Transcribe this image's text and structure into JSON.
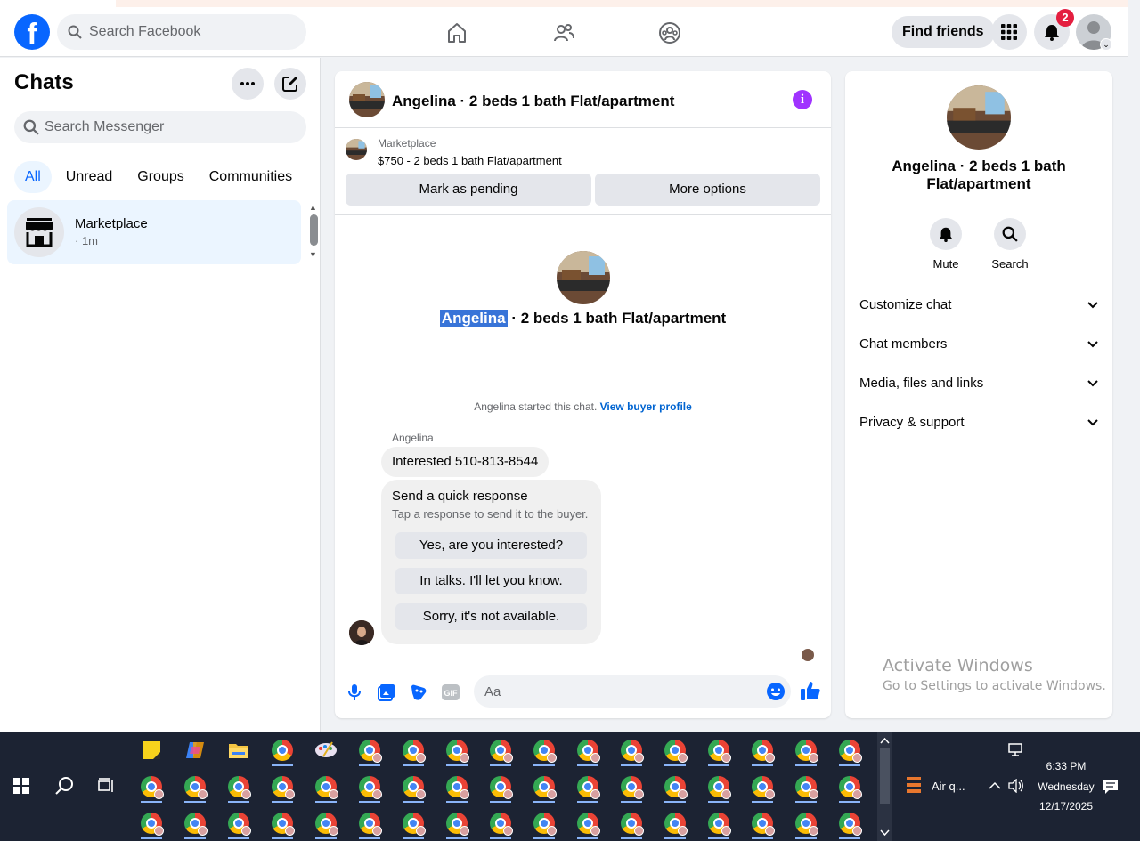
{
  "header": {
    "search_placeholder": "Search Facebook",
    "find_friends": "Find friends",
    "notification_count": "2"
  },
  "sidebar": {
    "title": "Chats",
    "search_placeholder": "Search Messenger",
    "filters": [
      "All",
      "Unread",
      "Groups",
      "Communities"
    ],
    "chat": {
      "name": "Marketplace",
      "time": "· 1m"
    }
  },
  "conversation": {
    "title": "Angelina · 2 beds 1 bath Flat/apartment",
    "marketplace_label": "Marketplace",
    "listing": "$750 - 2 beds 1 bath Flat/apartment",
    "mark_pending": "Mark as pending",
    "more_options": "More options",
    "center_name": "Angelina",
    "center_rest": " · 2 beds 1 bath Flat/apartment",
    "started_text": "Angelina started this chat.",
    "view_profile": "View buyer profile",
    "sender": "Angelina",
    "message": "Interested 510-813-8544",
    "quick_title": "Send a quick response",
    "quick_sub": "Tap a response to send it to the buyer.",
    "quick_replies": [
      "Yes, are you interested?",
      "In talks. I'll let you know.",
      "Sorry, it's not available."
    ],
    "composer_placeholder": "Aa"
  },
  "info_panel": {
    "name": "Angelina · 2 beds 1 bath Flat/apartment",
    "mute": "Mute",
    "search": "Search",
    "rows": [
      "Customize chat",
      "Chat members",
      "Media, files and links",
      "Privacy & support"
    ]
  },
  "watermark": {
    "line1": "Activate Windows",
    "line2": "Go to Settings to activate Windows."
  },
  "taskbar": {
    "air_quality": "Air q...",
    "time": "6:33 PM",
    "day": "Wednesday",
    "date": "12/17/2025"
  },
  "colors": {
    "brand": "#0866ff",
    "info_purple": "#a033ff",
    "badge_red": "#e41e3f",
    "selection": "#3874d8"
  }
}
